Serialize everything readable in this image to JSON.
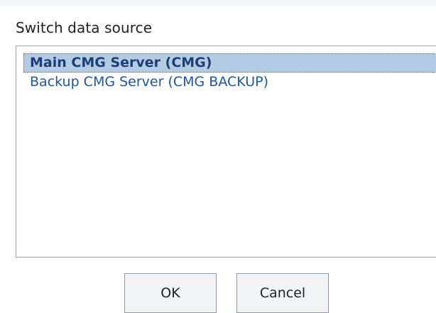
{
  "dialog": {
    "title": "Switch data source"
  },
  "data_sources": [
    {
      "label": "Main CMG Server (CMG)",
      "selected": true
    },
    {
      "label": "Backup CMG Server (CMG BACKUP)",
      "selected": false
    }
  ],
  "buttons": {
    "ok_label": "OK",
    "cancel_label": "Cancel"
  },
  "colors": {
    "selection_background": "#b4cbe4",
    "selected_text": "#1c3f78",
    "item_text": "#1f56a8",
    "list_border": "#a0a6ae",
    "button_background": "#f1f3f6"
  }
}
